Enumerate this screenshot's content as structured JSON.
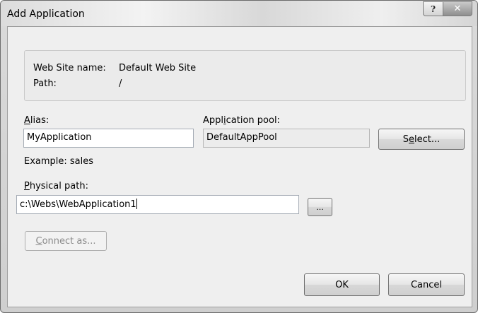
{
  "window": {
    "title": "Add Application",
    "help_glyph": "?",
    "close_glyph": "✕"
  },
  "site_info": {
    "site_name_label": "Web Site name:",
    "site_name_value": "Default Web Site",
    "path_label": "Path:",
    "path_value": "/"
  },
  "alias": {
    "label_accel": "A",
    "label_rest": "lias:",
    "value": "MyApplication",
    "example": "Example: sales"
  },
  "app_pool": {
    "label_pre": "Appl",
    "label_accel": "i",
    "label_post": "cation pool:",
    "value": "DefaultAppPool",
    "select_pre": "S",
    "select_accel": "e",
    "select_post": "lect..."
  },
  "physical_path": {
    "label_accel": "P",
    "label_rest": "hysical path:",
    "value": "c:\\Webs\\WebApplication1",
    "browse_label": "..."
  },
  "connect_as": {
    "label_accel": "C",
    "label_rest": "onnect as..."
  },
  "footer": {
    "ok_label": "OK",
    "cancel_label": "Cancel"
  },
  "colors": {
    "accent_text": "#000000",
    "disabled_text": "#8a8a8a"
  },
  "icons": [
    "help-icon",
    "close-icon"
  ]
}
